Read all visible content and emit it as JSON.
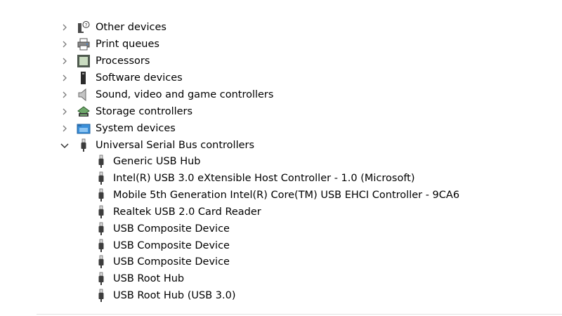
{
  "categories": [
    {
      "label": "Other devices",
      "icon": "unknown-device-icon",
      "expanded": false
    },
    {
      "label": "Print queues",
      "icon": "printer-icon",
      "expanded": false
    },
    {
      "label": "Processors",
      "icon": "processor-icon",
      "expanded": false
    },
    {
      "label": "Software devices",
      "icon": "software-device-icon",
      "expanded": false
    },
    {
      "label": "Sound, video and game controllers",
      "icon": "speaker-icon",
      "expanded": false
    },
    {
      "label": "Storage controllers",
      "icon": "storage-controller-icon",
      "expanded": false
    },
    {
      "label": "System devices",
      "icon": "system-folder-icon",
      "expanded": false
    },
    {
      "label": "Universal Serial Bus controllers",
      "icon": "usb-plug-icon",
      "expanded": true
    }
  ],
  "usb_devices": [
    {
      "label": "Generic USB Hub",
      "icon": "usb-plug-icon"
    },
    {
      "label": "Intel(R) USB 3.0 eXtensible Host Controller - 1.0 (Microsoft)",
      "icon": "usb-plug-icon"
    },
    {
      "label": "Mobile 5th Generation Intel(R) Core(TM) USB EHCI Controller - 9CA6",
      "icon": "usb-plug-icon"
    },
    {
      "label": "Realtek USB 2.0 Card Reader",
      "icon": "usb-plug-icon"
    },
    {
      "label": "USB Composite Device",
      "icon": "usb-plug-icon"
    },
    {
      "label": "USB Composite Device",
      "icon": "usb-plug-icon"
    },
    {
      "label": "USB Composite Device",
      "icon": "usb-plug-icon"
    },
    {
      "label": "USB Root Hub",
      "icon": "usb-plug-icon"
    },
    {
      "label": "USB Root Hub (USB 3.0)",
      "icon": "usb-plug-icon"
    }
  ]
}
